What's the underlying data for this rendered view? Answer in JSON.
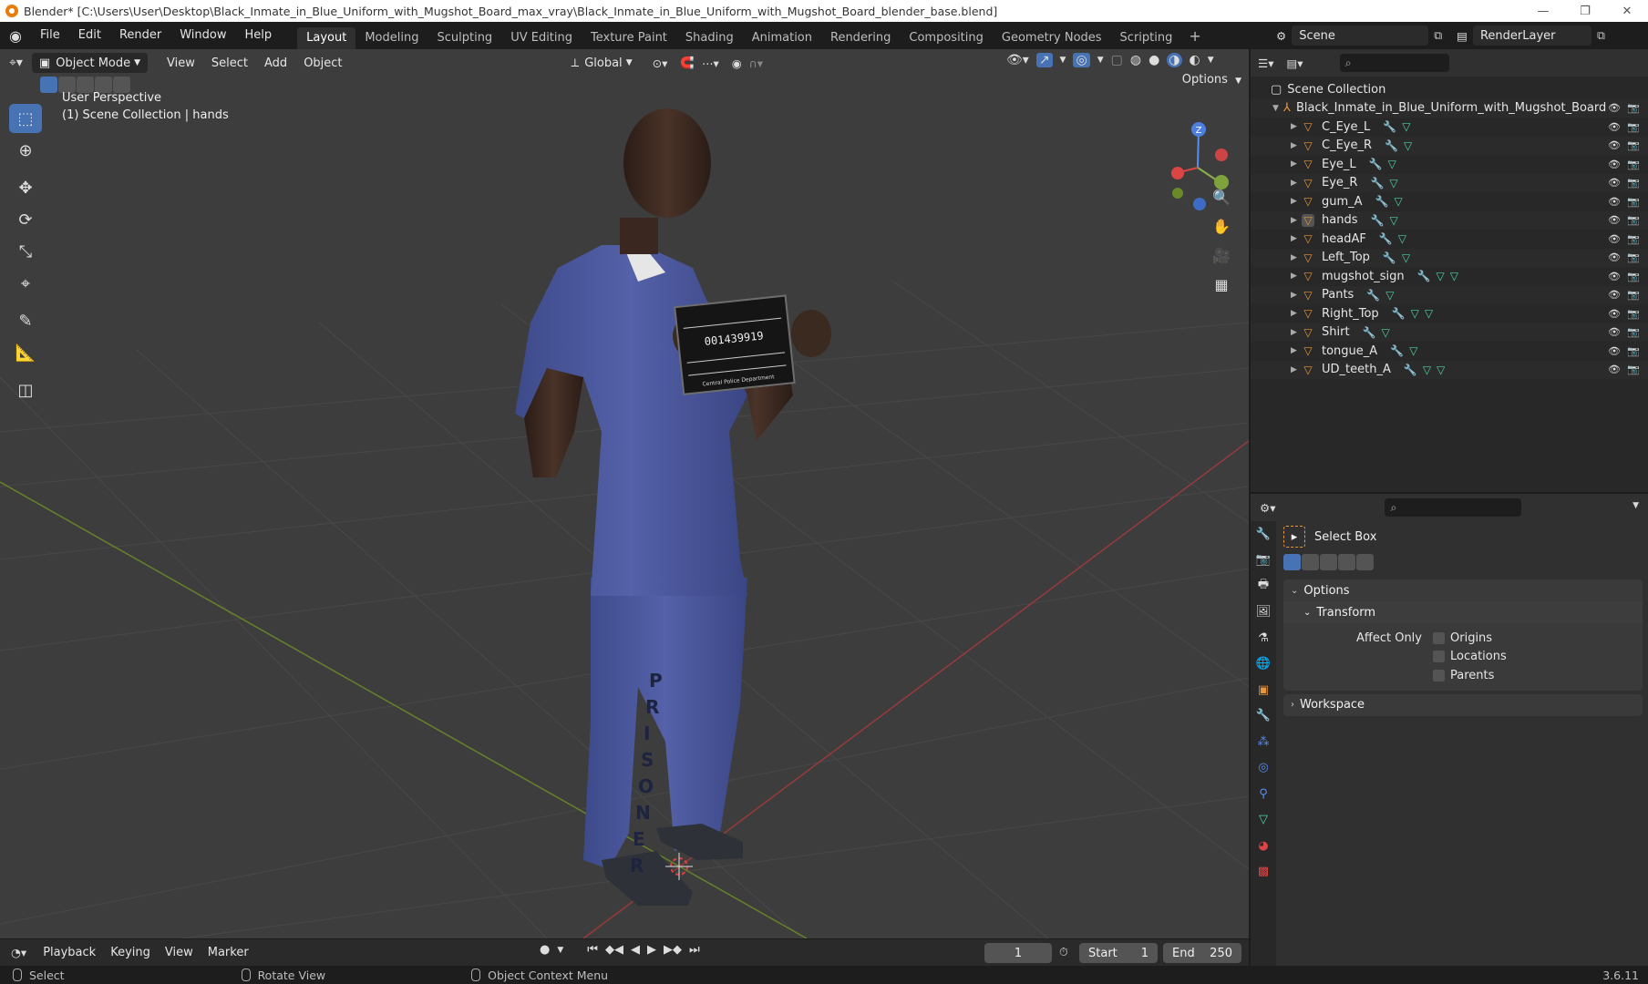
{
  "titlebar": {
    "title": "Blender* [C:\\Users\\User\\Desktop\\Black_Inmate_in_Blue_Uniform_with_Mugshot_Board_max_vray\\Black_Inmate_in_Blue_Uniform_with_Mugshot_Board_blender_base.blend]",
    "min": "—",
    "max": "❐",
    "close": "✕"
  },
  "menus": [
    "File",
    "Edit",
    "Render",
    "Window",
    "Help"
  ],
  "workspaces": [
    "Layout",
    "Modeling",
    "Sculpting",
    "UV Editing",
    "Texture Paint",
    "Shading",
    "Animation",
    "Rendering",
    "Compositing",
    "Geometry Nodes",
    "Scripting"
  ],
  "active_workspace": "Layout",
  "scene": {
    "scene_name": "Scene",
    "render_layer": "RenderLayer"
  },
  "viewport": {
    "mode": "Object Mode",
    "menus": [
      "View",
      "Select",
      "Add",
      "Object"
    ],
    "orientation": "Global",
    "info_line1": "User Perspective",
    "info_line2": "(1) Scene Collection | hands",
    "options": "Options",
    "axis_z": "Z",
    "mugshot_number": "001439919",
    "mugshot_footer": "Central Police Department",
    "pants_text": [
      "P",
      "R",
      "I",
      "S",
      "O",
      "N",
      "E",
      "R"
    ]
  },
  "outliner": {
    "root": "Scene Collection",
    "collection": "Black_Inmate_in_Blue_Uniform_with_Mugshot_Board",
    "objects": [
      "C_Eye_L",
      "C_Eye_R",
      "Eye_L",
      "Eye_R",
      "gum_A",
      "hands",
      "headAF",
      "Left_Top",
      "mugshot_sign",
      "Pants",
      "Right_Top",
      "Shirt",
      "tongue_A",
      "UD_teeth_A"
    ],
    "selected": "hands"
  },
  "properties": {
    "tool_name": "Select Box",
    "options_label": "Options",
    "transform_label": "Transform",
    "affect_only_label": "Affect Only",
    "checkboxes": [
      "Origins",
      "Locations",
      "Parents"
    ],
    "workspace_label": "Workspace"
  },
  "timeline": {
    "menus": [
      "Playback",
      "Keying",
      "View",
      "Marker"
    ],
    "current_frame": "1",
    "start_label": "Start",
    "start_value": "1",
    "end_label": "End",
    "end_value": "250"
  },
  "statusbar": {
    "select": "Select",
    "rotate": "Rotate View",
    "context": "Object Context Menu",
    "version": "3.6.11"
  },
  "colors": {
    "accent": "#4772b3",
    "object_orange": "#e8953b",
    "viewport_bg": "#3d3d3d",
    "uniform_blue": "#4b58a0"
  }
}
